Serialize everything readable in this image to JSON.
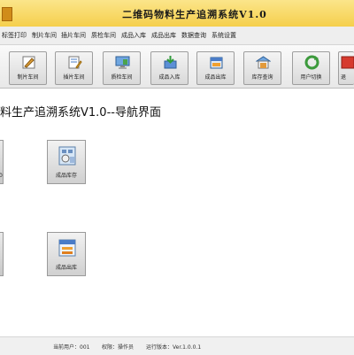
{
  "window": {
    "title": "二维码物料生产追溯系统V1.0"
  },
  "menu": {
    "items": [
      "标签打印",
      "制片车间",
      "插片车间",
      "质检车间",
      "成品入库",
      "成品出库",
      "数据查询",
      "系统设置"
    ]
  },
  "toolbar": {
    "buttons": [
      {
        "label": "制片车间",
        "icon": "pencil-note-icon"
      },
      {
        "label": "插片车间",
        "icon": "document-edit-icon"
      },
      {
        "label": "质检车间",
        "icon": "monitor-icon"
      },
      {
        "label": "成品入库",
        "icon": "inbound-box-icon"
      },
      {
        "label": "成品出库",
        "icon": "outbound-box-icon"
      },
      {
        "label": "库存查询",
        "icon": "warehouse-icon"
      },
      {
        "label": "用户切换",
        "icon": "refresh-icon"
      },
      {
        "label": "退",
        "icon": "exit-icon"
      }
    ]
  },
  "main": {
    "heading": "料生产追溯系统V1.0--导航界面",
    "tiles": [
      {
        "label": "成品库存",
        "icon": "inventory-icon"
      },
      {
        "label": "成品出库",
        "icon": "outbound-icon"
      }
    ],
    "left_edge_fragment": "0"
  },
  "status": {
    "current_user": "当前用户：001",
    "permission": "权限：操作员",
    "version": "运行版本：Ver.1.0.0.1"
  },
  "colors": {
    "titlebar": "#f5cf4c",
    "toolbar_bg": "#e8e8e8",
    "accent_red": "#d63a2e",
    "accent_green": "#3c9a3c"
  }
}
